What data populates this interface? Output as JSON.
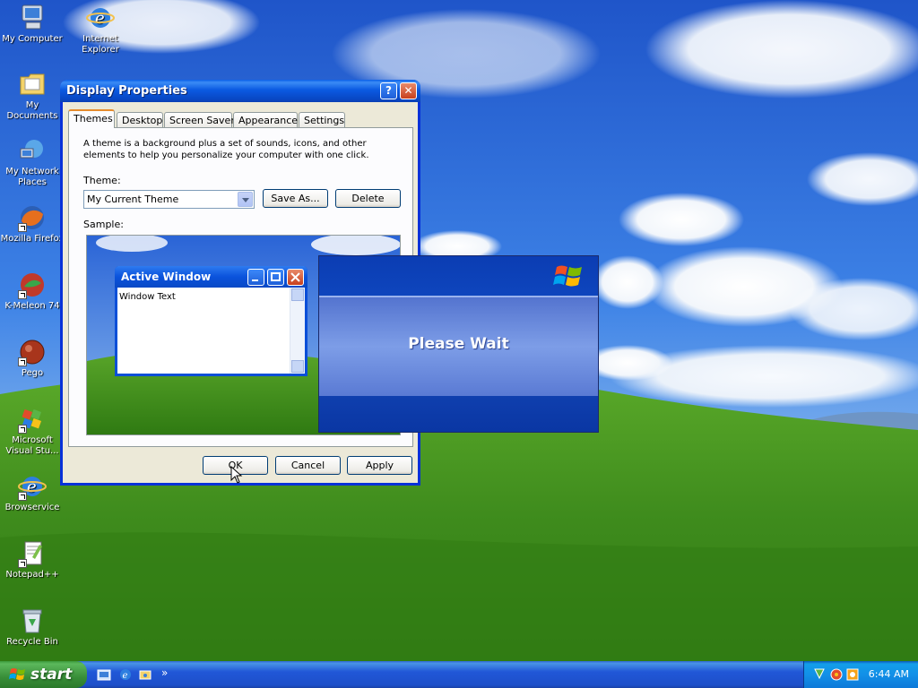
{
  "desktop": {
    "icons": [
      {
        "label": "My Computer",
        "icon": "my-computer-icon"
      },
      {
        "label": "Internet Explorer",
        "icon": "internet-explorer-icon"
      },
      {
        "label": "My Documents",
        "icon": "my-documents-icon"
      },
      {
        "label": "My Network Places",
        "icon": "network-places-icon"
      },
      {
        "label": "Mozilla Firefox",
        "icon": "firefox-icon"
      },
      {
        "label": "K-Meleon 74",
        "icon": "k-meleon-icon"
      },
      {
        "label": "Pego",
        "icon": "pego-icon"
      },
      {
        "label": "Microsoft Visual Stu...",
        "icon": "visual-studio-icon"
      },
      {
        "label": "Browservice",
        "icon": "browservice-icon"
      },
      {
        "label": "Notepad++",
        "icon": "notepad-plus-plus-icon"
      },
      {
        "label": "Recycle Bin",
        "icon": "recycle-bin-icon"
      }
    ]
  },
  "dialog": {
    "title": "Display Properties",
    "help_label": "?",
    "close_label": "✕",
    "tabs": [
      {
        "label": "Themes",
        "active": true
      },
      {
        "label": "Desktop"
      },
      {
        "label": "Screen Saver"
      },
      {
        "label": "Appearance"
      },
      {
        "label": "Settings"
      }
    ],
    "description": "A theme is a background plus a set of sounds, icons, and other elements to help you personalize your computer with one click.",
    "theme_label": "Theme:",
    "theme_value": "My Current Theme",
    "save_as_label": "Save As...",
    "delete_label": "Delete",
    "sample_label": "Sample:",
    "sample_window": {
      "title": "Active Window",
      "text": "Window Text"
    },
    "ok_label": "OK",
    "cancel_label": "Cancel",
    "apply_label": "Apply"
  },
  "please_wait": {
    "message": "Please Wait"
  },
  "taskbar": {
    "start_label": "start",
    "quick_launch": [
      "show-desktop-icon",
      "internet-explorer-icon",
      "windows-explorer-icon"
    ],
    "chevron": "»",
    "tray_icons": [
      "network-icon",
      "security-icon",
      "volume-icon"
    ],
    "clock": "6:44 AM"
  }
}
